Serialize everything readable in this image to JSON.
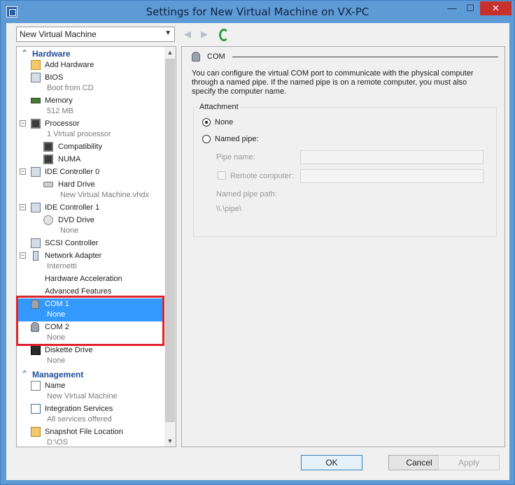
{
  "window": {
    "title": "Settings for New Virtual Machine on VX-PC",
    "min_symbol": "—",
    "max_symbol": "☐",
    "close_symbol": "✕"
  },
  "toolbar": {
    "vm_selected": "New Virtual Machine",
    "back_icon": "◀",
    "forward_icon": "▶"
  },
  "tree": {
    "hardware_header": "Hardware",
    "management_header": "Management",
    "items": {
      "add_hardware": "Add Hardware",
      "bios": "BIOS",
      "bios_sub": "Boot from CD",
      "memory": "Memory",
      "memory_sub": "512 MB",
      "processor": "Processor",
      "processor_sub": "1 Virtual processor",
      "compatibility": "Compatibility",
      "numa": "NUMA",
      "ide0": "IDE Controller 0",
      "hard_drive": "Hard Drive",
      "hard_drive_sub": "New Virtual Machine.vhdx",
      "ide1": "IDE Controller 1",
      "dvd": "DVD Drive",
      "dvd_sub": "None",
      "scsi": "SCSI Controller",
      "net": "Network Adapter",
      "net_sub": "Internetti",
      "hw_accel": "Hardware Acceleration",
      "adv_features": "Advanced Features",
      "com1": "COM 1",
      "com1_sub": "None",
      "com2": "COM 2",
      "com2_sub": "None",
      "diskette": "Diskette Drive",
      "diskette_sub": "None",
      "name": "Name",
      "name_sub": "New Virtual Machine",
      "integration": "Integration Services",
      "integration_sub": "All services offered",
      "snapshot": "Snapshot File Location",
      "snapshot_sub": "D:\\OS"
    }
  },
  "panel": {
    "title": "COM",
    "description": "You can configure the virtual COM port to communicate with the physical computer through a named pipe. If the named pipe is on a remote computer, you must also specify the computer name.",
    "attachment_legend": "Attachment",
    "radio_none": "None",
    "radio_named_pipe": "Named pipe:",
    "pipe_name_label": "Pipe name:",
    "remote_computer_label": "Remote computer:",
    "named_pipe_path_label": "Named pipe path:",
    "named_pipe_path_value": "\\\\.\\pipe\\"
  },
  "buttons": {
    "ok": "OK",
    "cancel": "Cancel",
    "apply": "Apply"
  }
}
